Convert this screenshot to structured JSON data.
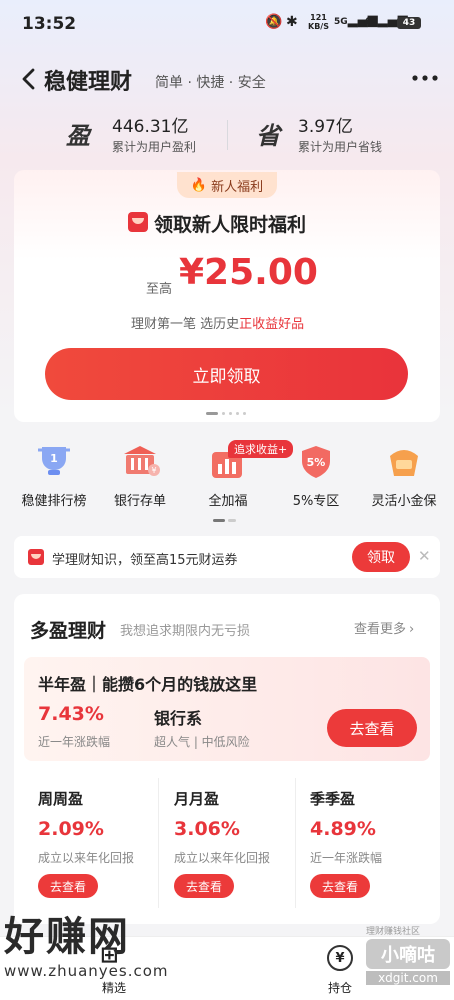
{
  "status_bar": {
    "time": "13:52",
    "net_speed_top": "121",
    "net_speed_bottom": "KB/S",
    "sig1": "5G",
    "sig2": "4G",
    "battery": "43"
  },
  "header": {
    "back_icon": "chevron-left-icon",
    "title": "稳健理财",
    "subtitle": "简单 · 快捷 · 安全",
    "more_icon": "more-icon"
  },
  "stats": [
    {
      "glyph": "盈",
      "value": "446.31亿",
      "label": "累计为用户盈利"
    },
    {
      "glyph": "省",
      "value": "3.97亿",
      "label": "累计为用户省钱"
    }
  ],
  "promo": {
    "badge": "新人福利",
    "heading": "领取新人限时福利",
    "prefix": "至高",
    "amount": "¥25.00",
    "desc_a": "理财第一笔 选历史",
    "desc_b": "正收益好品",
    "button": "立即领取"
  },
  "quick_links": [
    {
      "icon": "trophy-icon",
      "label": "稳健排行榜"
    },
    {
      "icon": "bank-icon",
      "label": "银行存单"
    },
    {
      "icon": "chart-icon",
      "label": "全加福",
      "badge": "追求收益+"
    },
    {
      "icon": "shield-icon",
      "label": "5%专区",
      "icon_text": "5%"
    },
    {
      "icon": "gold-icon",
      "label": "灵活小金保"
    }
  ],
  "notice": {
    "text": "学理财知识，领至高15元财运券",
    "button": "领取"
  },
  "duoying": {
    "title": "多盈理财",
    "subtitle": "我想追求期限内无亏损",
    "more": "查看更多",
    "feature": {
      "title": "半年盈｜能攒6个月的钱放这里",
      "rate": "7.43%",
      "rate_label": "近一年涨跌幅",
      "tag": "银行系",
      "tag_desc": "超人气 | 中低风险",
      "button": "去查看"
    },
    "products": [
      {
        "name": "周周盈",
        "rate": "2.09%",
        "label": "成立以来年化回报",
        "button": "去查看"
      },
      {
        "name": "月月盈",
        "rate": "3.06%",
        "label": "成立以来年化回报",
        "button": "去查看"
      },
      {
        "name": "季季盈",
        "rate": "4.89%",
        "label": "近一年涨跌幅",
        "button": "去查看"
      }
    ]
  },
  "bottom_nav": [
    {
      "label": "精选"
    },
    {
      "label": "持仓"
    }
  ],
  "watermark": {
    "left_big": "好赚网",
    "left_url": "www.zhuanyes.com",
    "right_big": "小嘀咕",
    "right_url": "xdgit.com",
    "right_tag": "理财赚钱社区"
  }
}
